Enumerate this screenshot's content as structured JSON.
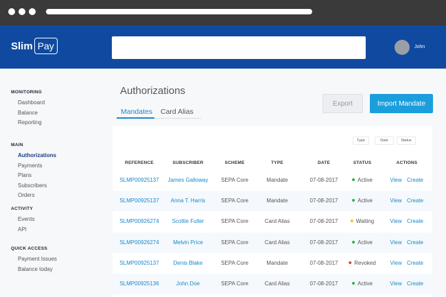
{
  "header": {
    "logo_text": "Slim",
    "logo_box_text": "Pay",
    "search_value": "",
    "search_placeholder": "",
    "user_name": "John"
  },
  "sidebar": {
    "sections": [
      {
        "title": "MONITORING",
        "items": [
          {
            "label": "Dashboard",
            "active": false
          },
          {
            "label": "Balance",
            "active": false
          },
          {
            "label": "Reporting",
            "active": false
          }
        ]
      },
      {
        "title": "MAIN",
        "items": [
          {
            "label": "Authorizations",
            "active": true
          },
          {
            "label": "Payments",
            "active": false
          },
          {
            "label": "Plans",
            "active": false
          },
          {
            "label": "Subscribers",
            "active": false
          },
          {
            "label": "Orders",
            "active": false
          }
        ]
      },
      {
        "title": "ACTIVITY",
        "items": [
          {
            "label": "Events",
            "active": false
          },
          {
            "label": "API",
            "active": false
          }
        ]
      },
      {
        "title": "QUICK ACCESS",
        "items": [
          {
            "label": "Payment Issues",
            "active": false
          },
          {
            "label": "Balance today",
            "active": false
          }
        ]
      }
    ]
  },
  "main": {
    "title": "Authorizations",
    "tabs": [
      {
        "label": "Mandates",
        "active": true
      },
      {
        "label": "Card Alias",
        "active": false
      }
    ],
    "export_label": "Export",
    "import_label": "Import Mandate",
    "filters": {
      "type": "Type",
      "date": "Date",
      "status": "Status"
    }
  },
  "table": {
    "headers": [
      "REFERENCE",
      "SUBSCRIBER",
      "SCHEME",
      "TYPE",
      "DATE",
      "STATUS",
      "ACTIONS"
    ],
    "rows": [
      {
        "reference": "SLMP00925137",
        "subscriber": "James Galloway",
        "scheme": "SEPA Core",
        "type": "Mandate",
        "date": "07-08-2017",
        "status": "Active",
        "status_color": "#2bb24c"
      },
      {
        "reference": "SLMP00925137",
        "subscriber": "Anna T. Harris",
        "scheme": "SEPA Core",
        "type": "Mandate",
        "date": "07-08-2017",
        "status": "Active",
        "status_color": "#2bb24c"
      },
      {
        "reference": "SLMP00926274",
        "subscriber": "Scottie Fuller",
        "scheme": "SEPA Core",
        "type": "Card Alias",
        "date": "07-08-2017",
        "status": "Waiting",
        "status_color": "#f5c02c"
      },
      {
        "reference": "SLMP00926274",
        "subscriber": "Melvin Price",
        "scheme": "SEPA Core",
        "type": "Card Alias",
        "date": "07-08-2017",
        "status": "Active",
        "status_color": "#2bb24c"
      },
      {
        "reference": "SLMP00925137",
        "subscriber": "Denis Blake",
        "scheme": "SEPA Core",
        "type": "Mandate",
        "date": "07-08-2017",
        "status": "Revoked",
        "status_color": "#e0453b"
      },
      {
        "reference": "SLMP00925136",
        "subscriber": "John Doe",
        "scheme": "SEPA Core",
        "type": "Card Alias",
        "date": "07-08-2017",
        "status": "Active",
        "status_color": "#2bb24c"
      }
    ],
    "action_view": "View",
    "action_create": "Create"
  }
}
